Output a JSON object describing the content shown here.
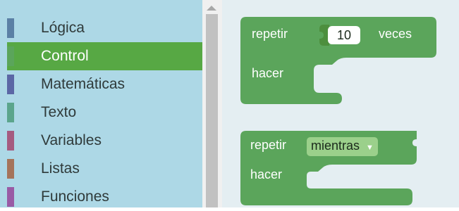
{
  "toolbox": {
    "categories": [
      {
        "label": "Lógica",
        "color": "#5b80a5",
        "selected": false
      },
      {
        "label": "Control",
        "color": "#5ba55b",
        "selected": true
      },
      {
        "label": "Matemáticas",
        "color": "#5b67a5",
        "selected": false
      },
      {
        "label": "Texto",
        "color": "#5ba58c",
        "selected": false
      },
      {
        "label": "Variables",
        "color": "#a55b80",
        "selected": false
      },
      {
        "label": "Listas",
        "color": "#a5745b",
        "selected": false
      },
      {
        "label": "Funciones",
        "color": "#995ba5",
        "selected": false
      }
    ]
  },
  "workspace": {
    "block_repeat": {
      "keyword": "repetir",
      "count": "10",
      "suffix": "veces",
      "do_label": "hacer"
    },
    "block_while": {
      "keyword": "repetir",
      "mode": "mientras",
      "do_label": "hacer"
    },
    "block_color": "#5ba55b"
  }
}
